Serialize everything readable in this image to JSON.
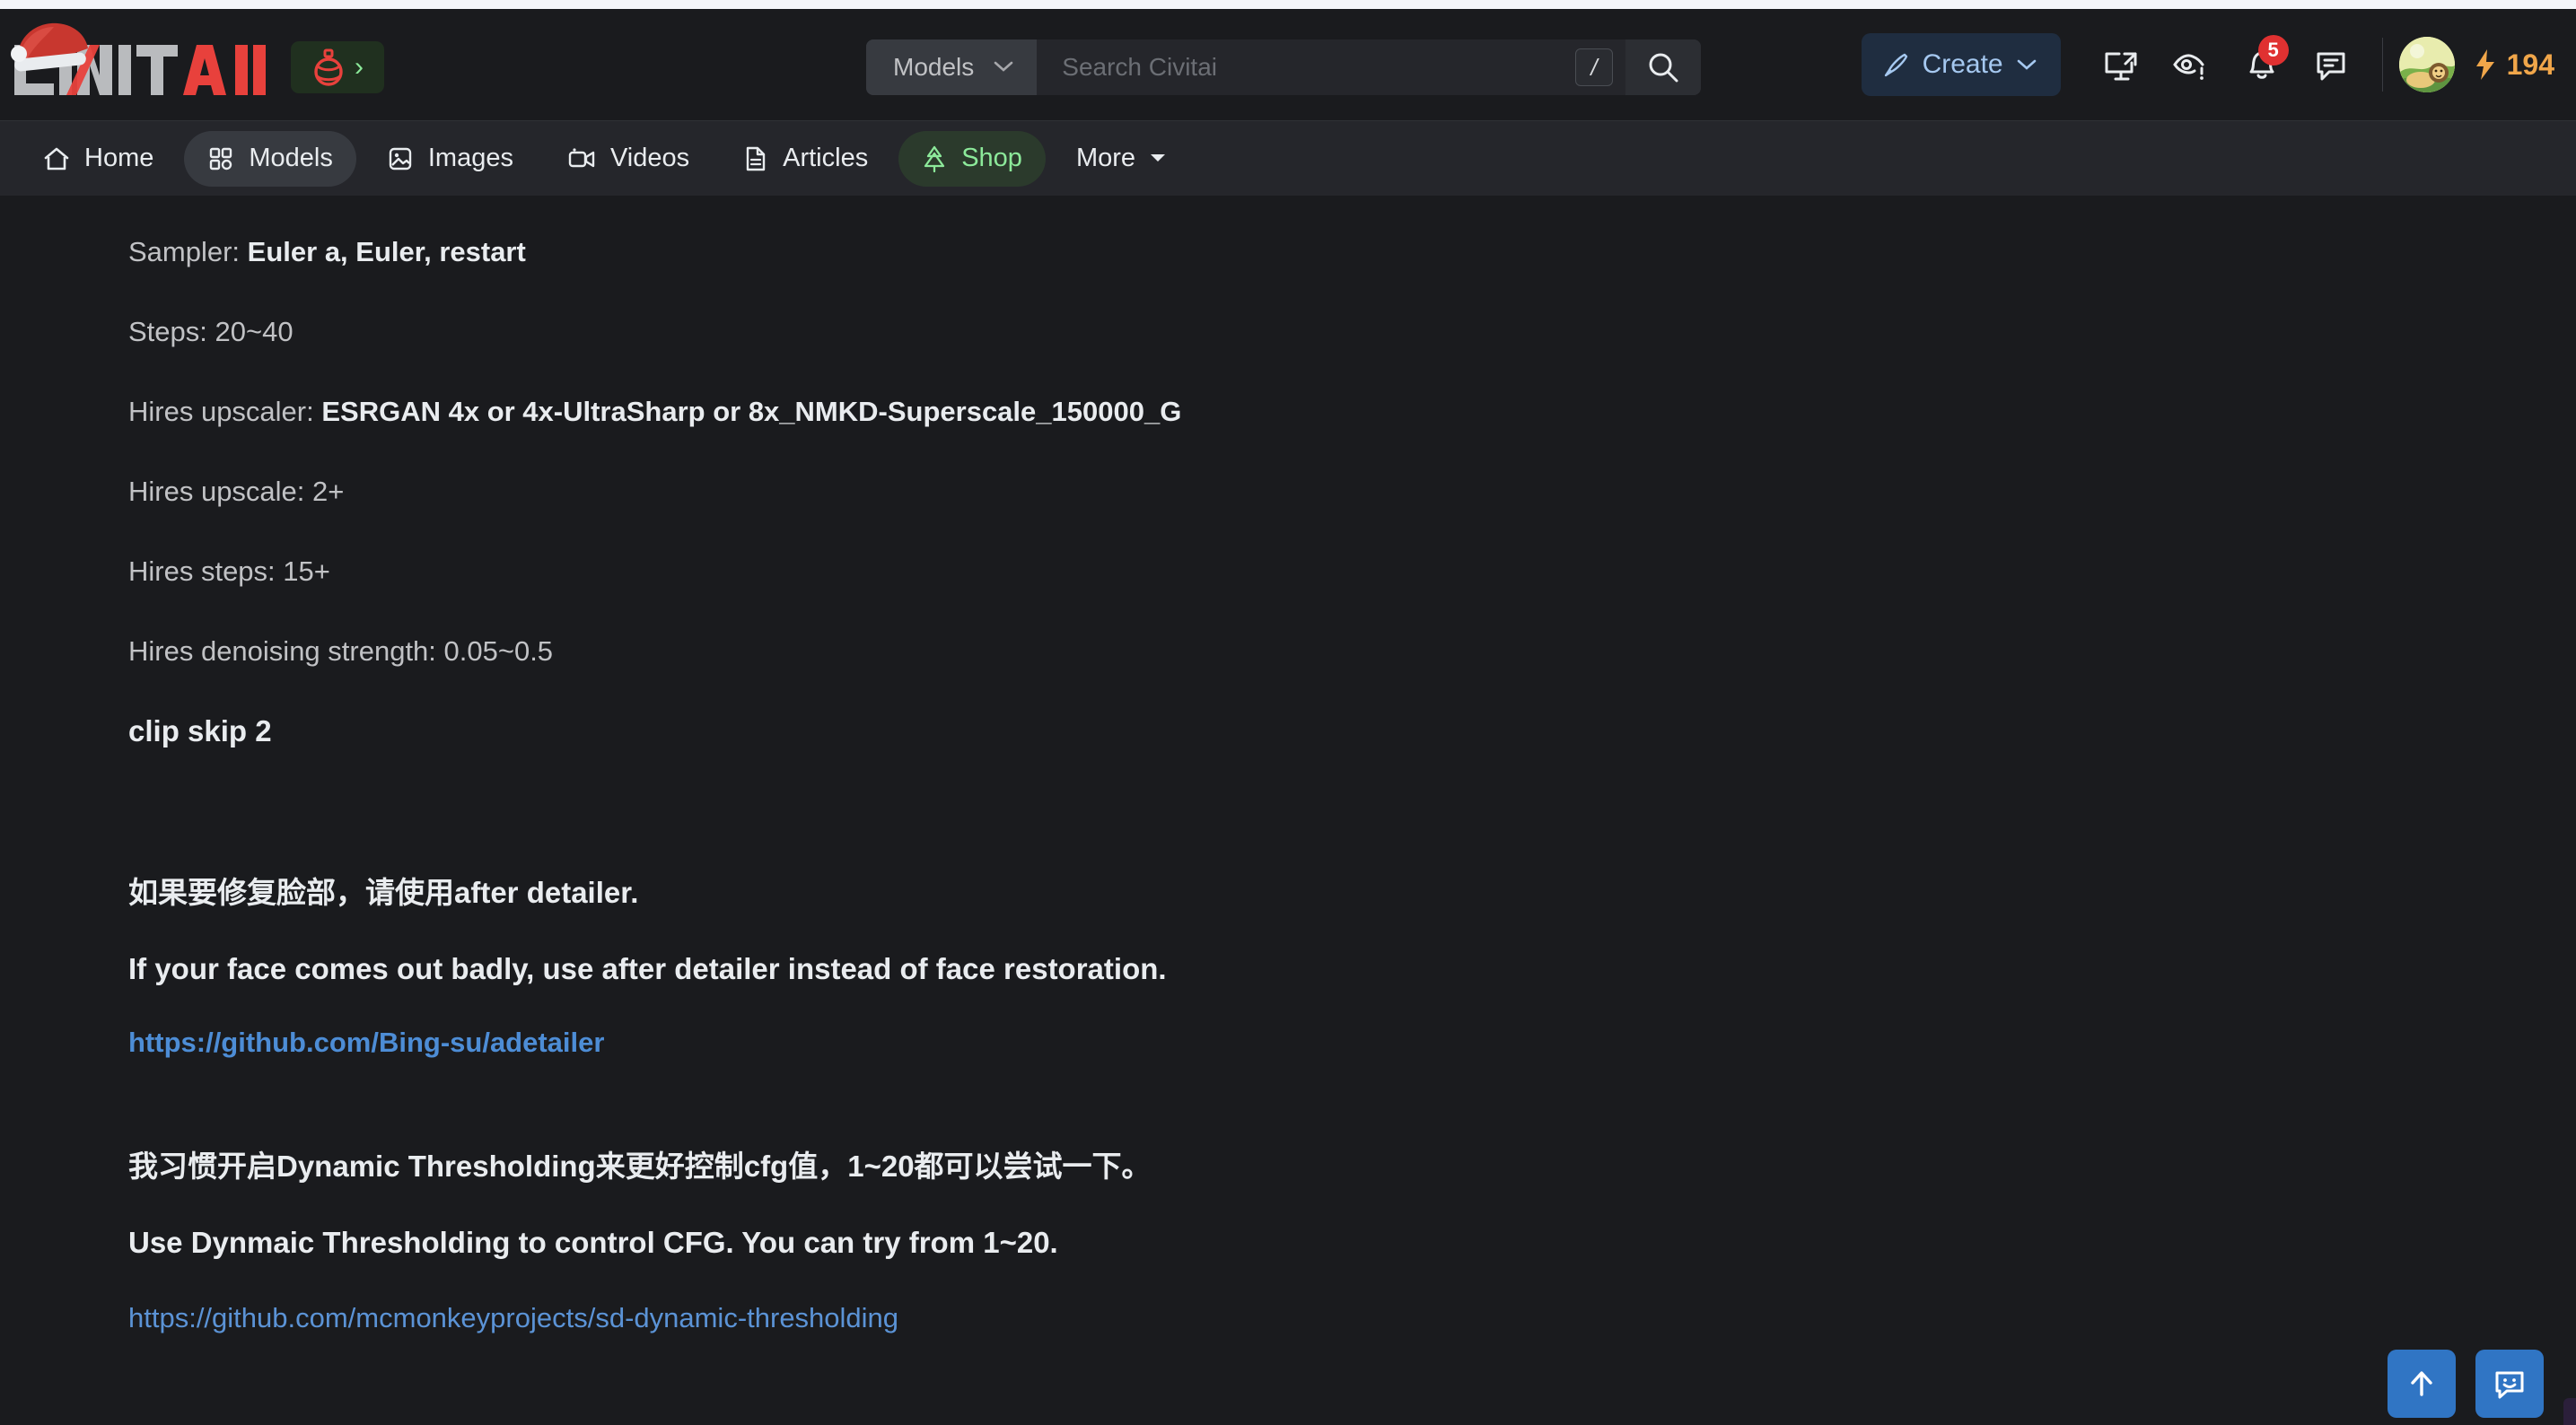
{
  "site": {
    "brand_name": "CIVITAI",
    "brand_accent_color": "#e8413c",
    "brand_text_color": "#b9bbbe"
  },
  "header": {
    "xmas_badge": {
      "icon": "ornament-icon",
      "chevron": "›",
      "color": "#e8413c"
    },
    "search": {
      "scope_label": "Models",
      "scope_chevron": "⌄",
      "placeholder": "Search Civitai",
      "value": "",
      "shortcut_key": "/",
      "search_icon": "search-icon"
    },
    "create_button": {
      "label": "Create",
      "icon": "brush-icon",
      "chevron": "⌄",
      "color": "#a5c8f0"
    },
    "icons": [
      {
        "name": "screen-share-icon",
        "title": "Share"
      },
      {
        "name": "eye-alert-icon",
        "title": "Content preferences"
      },
      {
        "name": "bell-icon",
        "title": "Notifications",
        "badge": "5"
      },
      {
        "name": "chat-bubble-icon",
        "title": "Chat"
      }
    ],
    "notification_badge": "5",
    "badge_color": "#e03131",
    "avatar": {
      "name": "avatar",
      "alt": "lion avatar"
    },
    "buzz": {
      "icon": "lightning-bolt-icon",
      "value": "194",
      "color": "#f0a64a"
    }
  },
  "nav": {
    "items": [
      {
        "label": "Home",
        "icon": "home-icon",
        "active": false
      },
      {
        "label": "Models",
        "icon": "grid-icon",
        "active": true
      },
      {
        "label": "Images",
        "icon": "image-icon",
        "active": false
      },
      {
        "label": "Videos",
        "icon": "video-icon",
        "active": false
      },
      {
        "label": "Articles",
        "icon": "document-icon",
        "active": false
      },
      {
        "label": "Shop",
        "icon": "tree-icon",
        "active": false,
        "highlight": "green"
      },
      {
        "label": "More",
        "icon": "caret-down-icon",
        "active": false
      }
    ],
    "shop_color": "#8ce99a"
  },
  "main": {
    "lines": [
      {
        "label": "Sampler: ",
        "value": "Euler a, Euler, restart",
        "bold_value": true
      },
      {
        "label": "Steps: 20~40",
        "value": "",
        "bold_value": false
      },
      {
        "label": "Hires upscaler: ",
        "value": "ESRGAN 4x or 4x-UltraSharp or 8x_NMKD-Superscale_150000_G",
        "bold_value": true
      },
      {
        "label": "Hires upscale: 2+",
        "value": "",
        "bold_value": false
      },
      {
        "label": "Hires steps: 15+",
        "value": "",
        "bold_value": false
      },
      {
        "label": "Hires denoising strength: 0.05~0.5",
        "value": "",
        "bold_value": false
      }
    ],
    "clip_skip": "clip skip 2",
    "note_cn_1": "如果要修复脸部，请使用after detailer.",
    "note_en_1": "If your face comes out badly, use after detailer instead of face restoration.",
    "link_1": "https://github.com/Bing-su/adetailer",
    "note_cn_2": "我习惯开启Dynamic Thresholding来更好控制cfg值，1~20都可以尝试一下。",
    "note_en_2": "Use Dynmaic Thresholding to control CFG. You can try from 1~20.",
    "link_2": "https://github.com/mcmonkeyprojects/sd-dynamic-thresholding",
    "link_color": "#4d8dd6"
  },
  "fabs": [
    {
      "name": "scroll-to-top-button",
      "icon": "arrow-up-icon"
    },
    {
      "name": "feedback-button",
      "icon": "chat-smiley-icon"
    }
  ]
}
